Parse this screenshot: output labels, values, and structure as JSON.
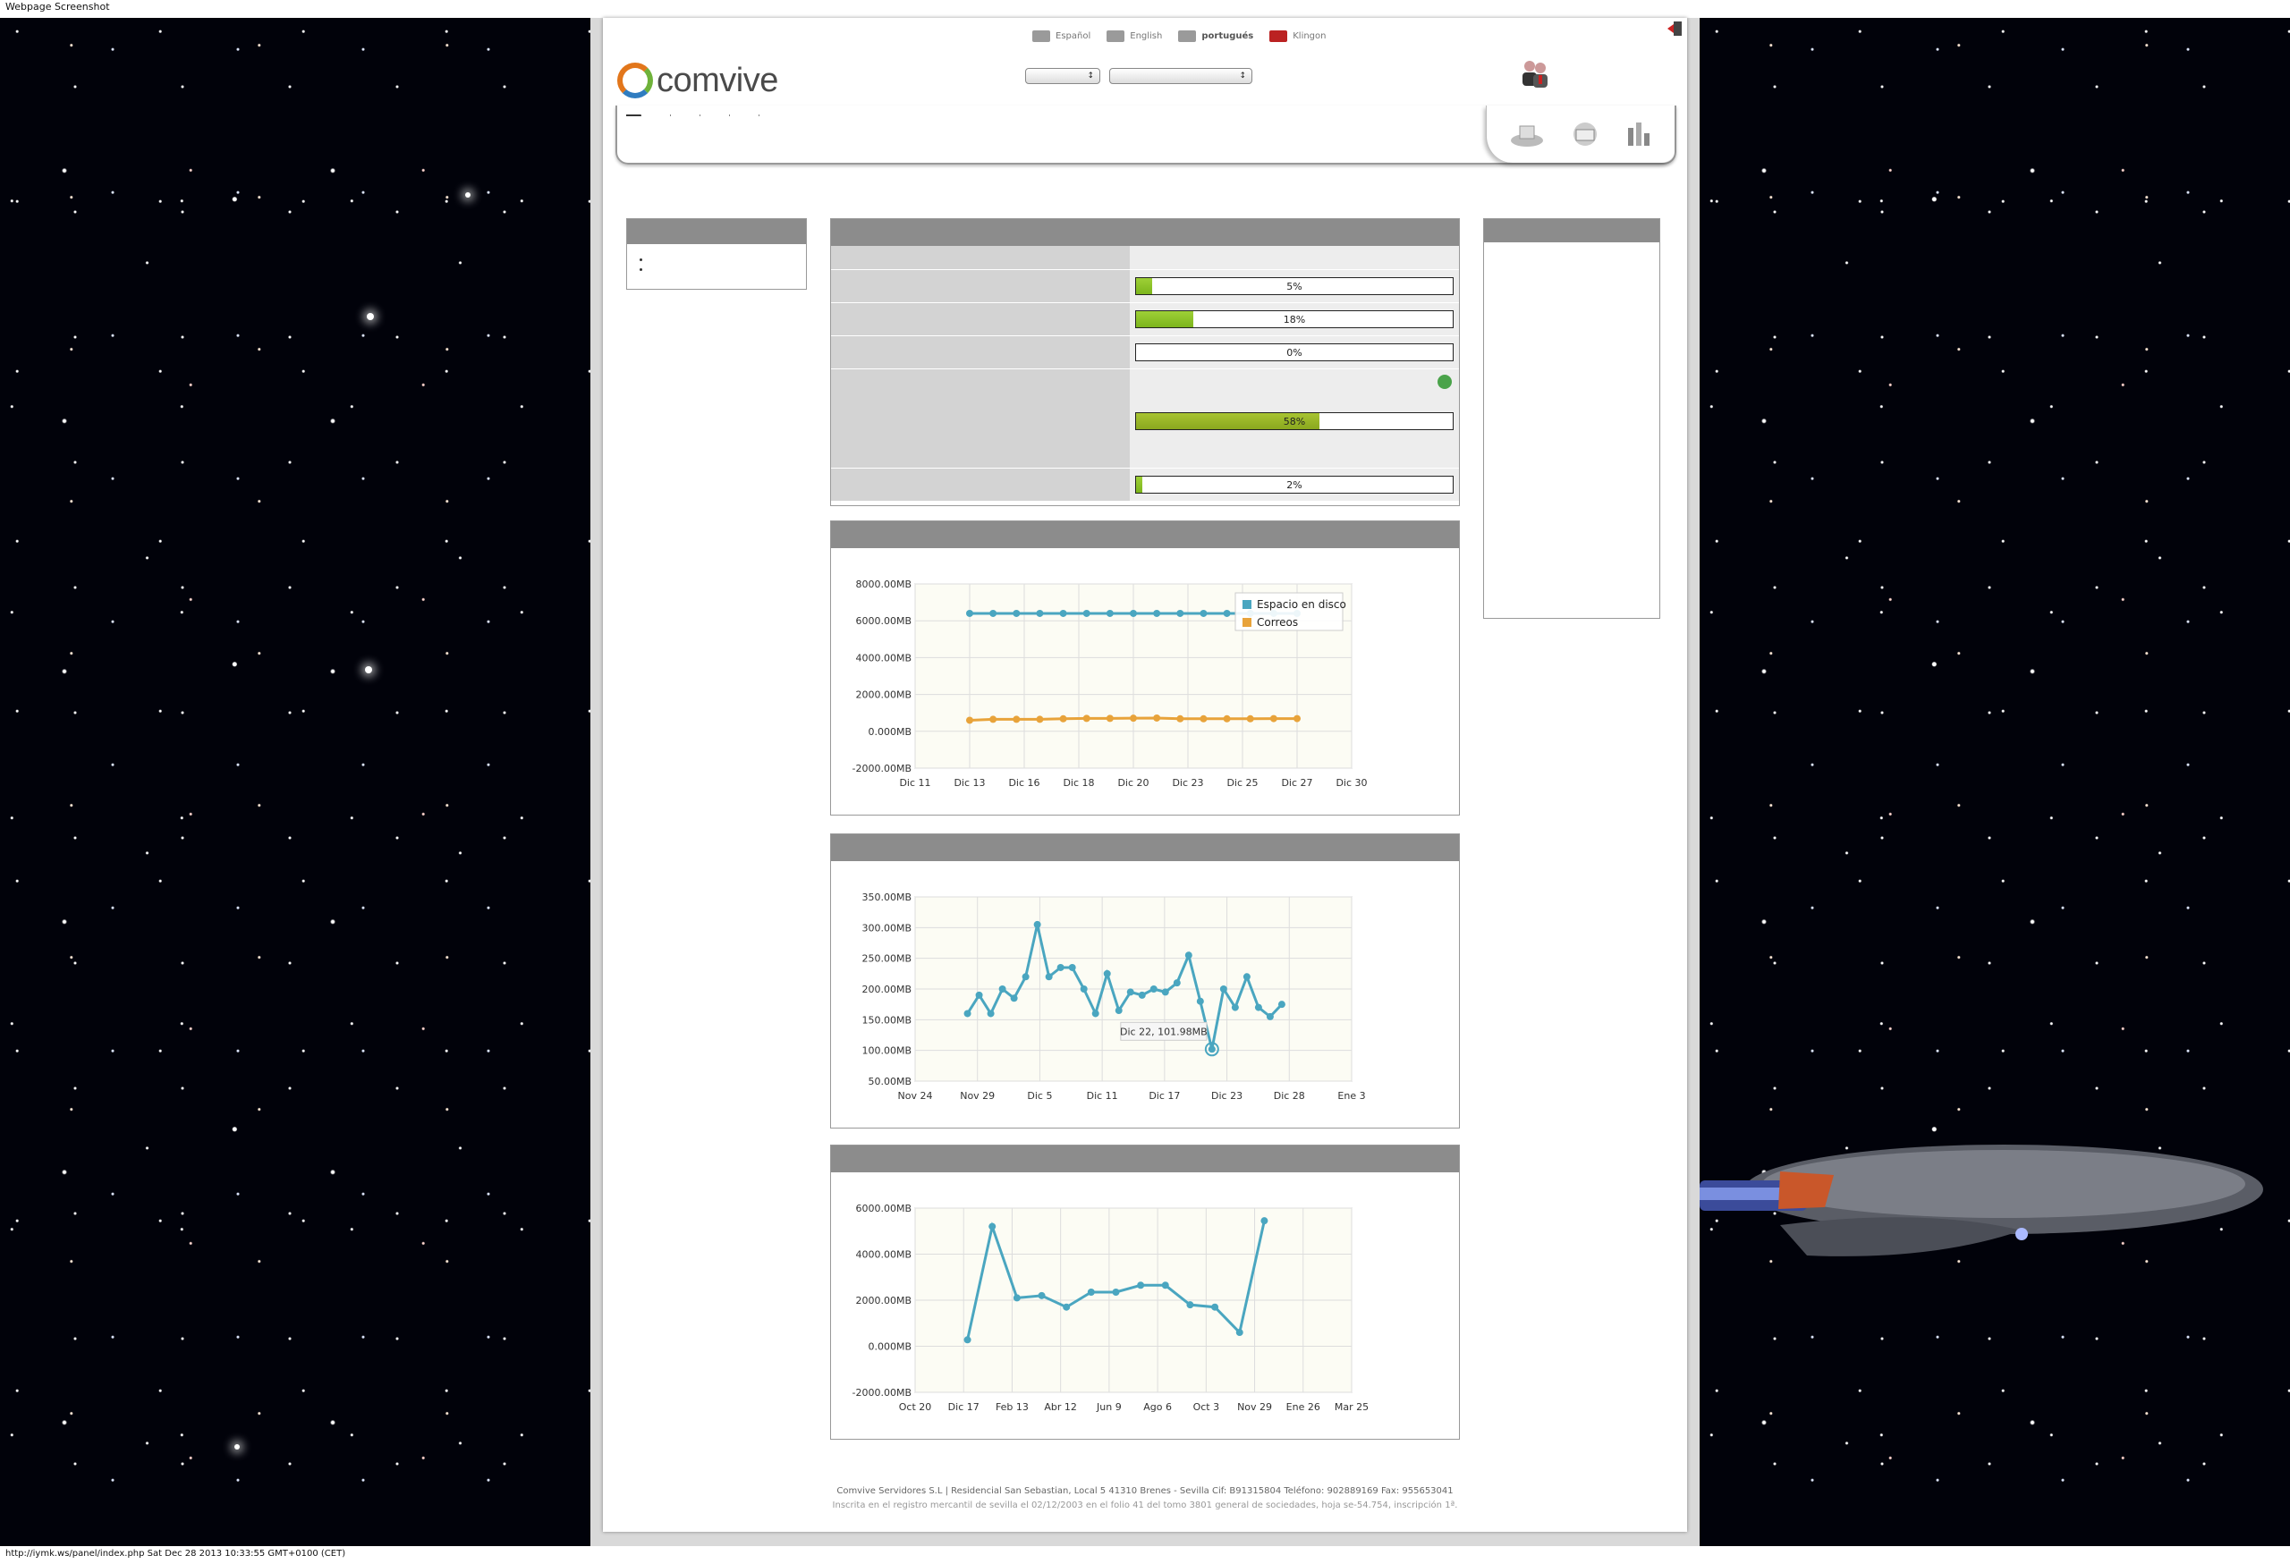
{
  "window": {
    "title": "Webpage Screenshot",
    "status_line": "http://iymk.ws/panel/index.php Sat Dec 28 2013 10:33:55 GMT+0100 (CET)"
  },
  "logo": {
    "text": "comvive"
  },
  "languages": [
    {
      "label": "Español",
      "selected": false
    },
    {
      "label": "English",
      "selected": false
    },
    {
      "label": "portugués",
      "selected": true
    },
    {
      "label": "Klingon",
      "selected": false
    }
  ],
  "selects": {
    "account_value": "",
    "action_value": ""
  },
  "user": {
    "line1": "",
    "line2": ""
  },
  "nav": {
    "items": [
      "",
      "",
      "",
      "",
      "",
      ""
    ]
  },
  "left_menu": {
    "title": "",
    "items": [
      "",
      ""
    ]
  },
  "stats_panel": {
    "title": "",
    "rows": [
      {
        "label": "",
        "value_text": ""
      },
      {
        "label": "",
        "percent": 5,
        "text": "5%"
      },
      {
        "label": "",
        "percent": 18,
        "text": "18%"
      },
      {
        "label": "",
        "percent": 0,
        "text": "0%"
      },
      {
        "label": "",
        "percent": 58,
        "text": "58%",
        "lines": [
          "",
          "",
          "",
          ""
        ]
      },
      {
        "label": "",
        "percent": 2,
        "text": "2%"
      }
    ]
  },
  "news": {
    "title": "",
    "paragraphs": [
      "",
      "",
      ""
    ]
  },
  "colors": {
    "series_blue": "#4aa6c0",
    "series_orange": "#e8a33a",
    "panel_header": "#8c8c8c",
    "plot_bg": "#fcfcf4",
    "bar_green": "#8cc42a"
  },
  "chart_data": [
    {
      "type": "line",
      "title": "",
      "x": [
        "Dic 13",
        "Dic 14",
        "Dic 15",
        "Dic 16",
        "Dic 17",
        "Dic 18",
        "Dic 19",
        "Dic 20",
        "Dic 21",
        "Dic 22",
        "Dic 23",
        "Dic 24",
        "Dic 25",
        "Dic 26",
        "Dic 27"
      ],
      "x_ticks": [
        "Dic 11",
        "Dic 13",
        "Dic 16",
        "Dic 18",
        "Dic 20",
        "Dic 23",
        "Dic 25",
        "Dic 27",
        "Dic 30"
      ],
      "y_ticks": [
        "8000.00MB",
        "6000.00MB",
        "4000.00MB",
        "2000.00MB",
        "0.000MB",
        "-2000.00MB"
      ],
      "ylim": [
        -2000,
        8000
      ],
      "grid": true,
      "legend_position": "top-right",
      "series": [
        {
          "name": "Espacio en disco",
          "values": [
            6400,
            6400,
            6400,
            6400,
            6400,
            6400,
            6400,
            6400,
            6400,
            6400,
            6400,
            6400,
            6400,
            6400,
            6400
          ]
        },
        {
          "name": "Correos",
          "values": [
            600,
            650,
            650,
            650,
            680,
            700,
            700,
            710,
            720,
            680,
            680,
            680,
            680,
            690,
            690
          ]
        }
      ]
    },
    {
      "type": "line",
      "title": "",
      "x_ticks": [
        "Nov 24",
        "Nov 29",
        "Dic 5",
        "Dic 11",
        "Dic 17",
        "Dic 23",
        "Dic 28",
        "Ene 3"
      ],
      "y_ticks": [
        "350.00MB",
        "300.00MB",
        "250.00MB",
        "200.00MB",
        "150.00MB",
        "100.00MB",
        "50.00MB"
      ],
      "ylim": [
        50,
        350
      ],
      "grid": true,
      "tooltip": "Dic 22, 101.98MB",
      "series": [
        {
          "name": "",
          "values": [
            160,
            190,
            160,
            200,
            185,
            220,
            305,
            220,
            235,
            235,
            200,
            160,
            225,
            165,
            195,
            190,
            200,
            195,
            210,
            255,
            180,
            102,
            200,
            170,
            220,
            170,
            155,
            175
          ]
        }
      ]
    },
    {
      "type": "line",
      "title": "",
      "x_ticks": [
        "Oct 20",
        "Dic 17",
        "Feb 13",
        "Abr 12",
        "Jun 9",
        "Ago 6",
        "Oct 3",
        "Nov 29",
        "Ene 26",
        "Mar 25"
      ],
      "y_ticks": [
        "6000.00MB",
        "4000.00MB",
        "2000.00MB",
        "0.000MB",
        "-2000.00MB"
      ],
      "ylim": [
        -2000,
        6000
      ],
      "grid": true,
      "series": [
        {
          "name": "",
          "values": [
            280,
            5200,
            2100,
            2200,
            1700,
            2350,
            2350,
            2650,
            2650,
            1800,
            1700,
            600,
            5450
          ]
        }
      ]
    }
  ],
  "footer": {
    "line1": "Comvive Servidores S.L | Residencial San Sebastian, Local 5 41310 Brenes - Sevilla Cif: B91315804 Teléfono: 902889169 Fax: 955653041",
    "line2": "Inscrita en el registro mercantil de sevilla el 02/12/2003 en el folio 41 del tomo 3801 general de sociedades, hoja se-54.754, inscripción 1ª."
  }
}
